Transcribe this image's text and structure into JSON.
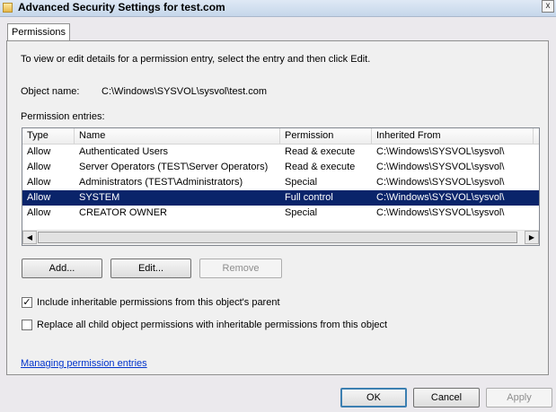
{
  "window": {
    "title": "Advanced Security Settings for test.com",
    "close_label": "x"
  },
  "tabs": [
    {
      "label": "Permissions"
    }
  ],
  "instructions": "To view or edit details for a permission entry, select the entry and then click Edit.",
  "object": {
    "label": "Object name:",
    "value": "C:\\Windows\\SYSVOL\\sysvol\\test.com"
  },
  "entries_label": "Permission entries:",
  "table": {
    "headers": [
      "Type",
      "Name",
      "Permission",
      "Inherited From"
    ],
    "rows": [
      [
        "Allow",
        "Authenticated Users",
        "Read & execute",
        "C:\\Windows\\SYSVOL\\sysvol\\"
      ],
      [
        "Allow",
        "Server Operators (TEST\\Server Operators)",
        "Read & execute",
        "C:\\Windows\\SYSVOL\\sysvol\\"
      ],
      [
        "Allow",
        "Administrators (TEST\\Administrators)",
        "Special",
        "C:\\Windows\\SYSVOL\\sysvol\\"
      ],
      [
        "Allow",
        "SYSTEM",
        "Full control",
        "C:\\Windows\\SYSVOL\\sysvol\\"
      ],
      [
        "Allow",
        "CREATOR OWNER",
        "Special",
        "C:\\Windows\\SYSVOL\\sysvol\\"
      ]
    ],
    "selected_row": 3
  },
  "buttons": {
    "add": "Add...",
    "edit": "Edit...",
    "remove": "Remove"
  },
  "checkboxes": {
    "include_inheritable": {
      "label": "Include inheritable permissions from this object's parent",
      "checked": true
    },
    "replace_child": {
      "label": "Replace all child object permissions with inheritable permissions from this object",
      "checked": false
    }
  },
  "link": "Managing permission entries",
  "footer": {
    "ok": "OK",
    "cancel": "Cancel",
    "apply": "Apply"
  },
  "icons": {
    "window": "folder-icon",
    "close": "close-icon",
    "scroll_left": "arrow-left-icon",
    "scroll_right": "arrow-right-icon"
  },
  "colors": {
    "selection": "#0a246a",
    "link": "#0033cc"
  }
}
